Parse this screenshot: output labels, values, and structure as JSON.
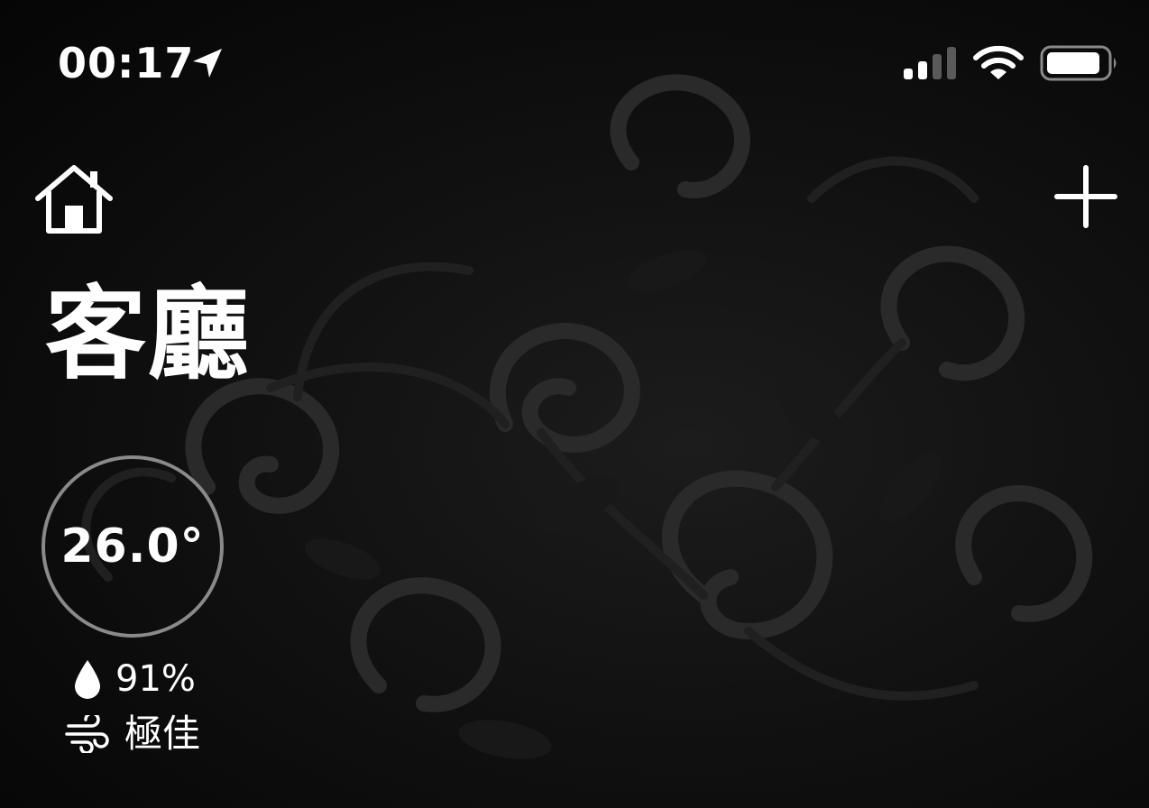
{
  "status_bar": {
    "time": "00:17",
    "icons": [
      "location-arrow-icon",
      "cellular-signal-icon",
      "wifi-icon",
      "battery-icon"
    ]
  },
  "header": {
    "home_icon": "home-icon",
    "add_icon": "plus-icon"
  },
  "room": {
    "title": "客廳"
  },
  "climate": {
    "temperature": "26.0°",
    "humidity": "91%",
    "humidity_icon": "water-drop-icon",
    "air_quality": "極佳",
    "air_quality_icon": "wind-icon"
  },
  "colors": {
    "background": "#0a0a0a",
    "text": "#ffffff",
    "ring": "#8a8a8a"
  }
}
